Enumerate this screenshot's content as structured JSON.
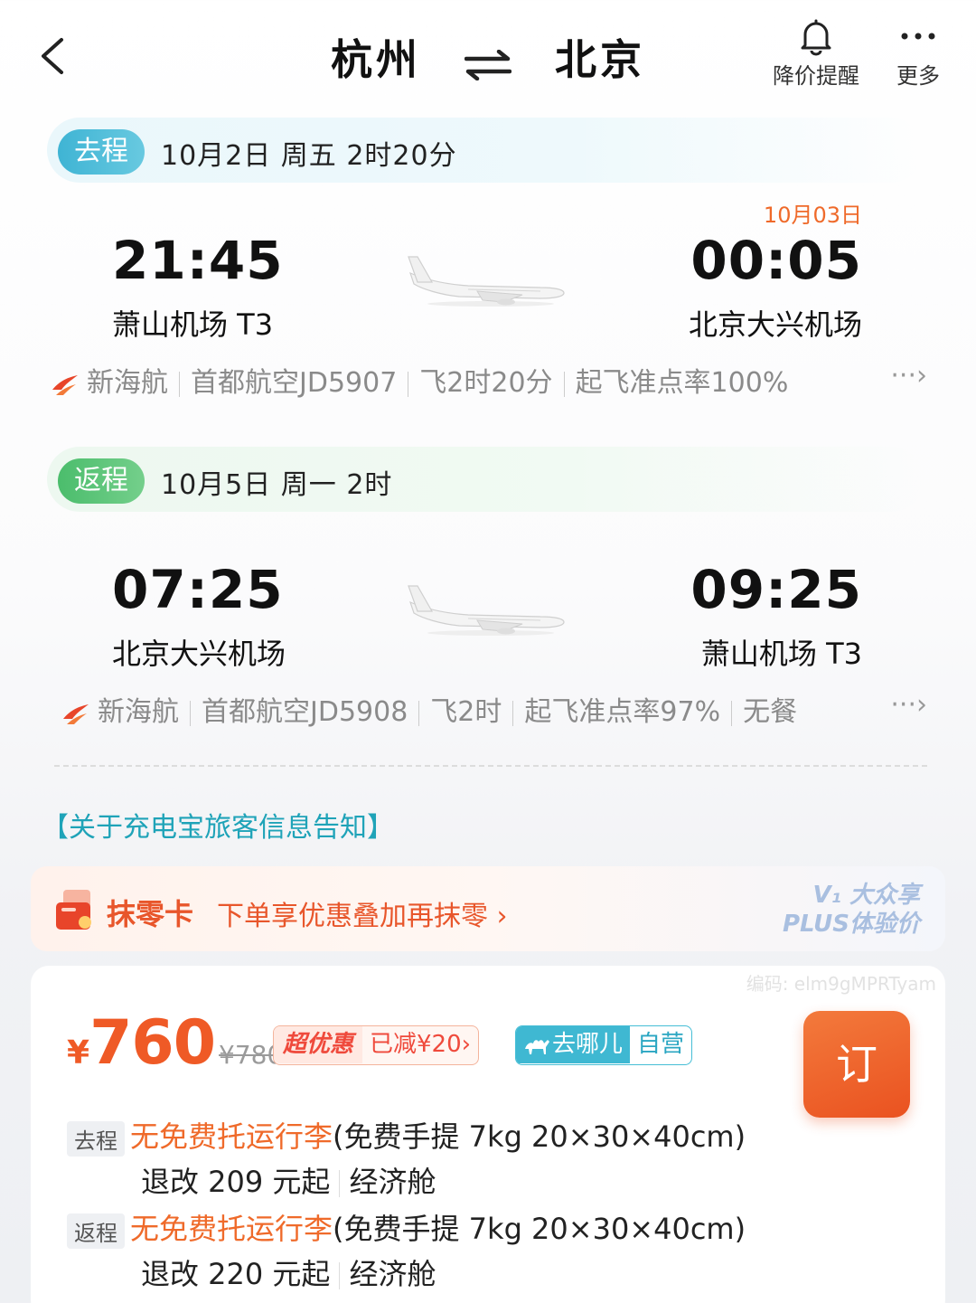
{
  "header": {
    "from_city": "杭州",
    "to_city": "北京",
    "price_alert_label": "降价提醒",
    "more_label": "更多"
  },
  "outbound": {
    "tag": "去程",
    "summary": "10月2日 周五  2时20分",
    "dep_time": "21:45",
    "dep_airport": "萧山机场 T3",
    "arr_time": "00:05",
    "arr_airport": "北京大兴机场",
    "arr_date_note": "10月03日",
    "info": [
      "新海航",
      "首都航空JD5907",
      "飞2时20分",
      "起飞准点率100%"
    ],
    "more": "···›"
  },
  "return": {
    "tag": "返程",
    "summary": "10月5日 周一  2时",
    "dep_time": "07:25",
    "dep_airport": "北京大兴机场",
    "arr_time": "09:25",
    "arr_airport": "萧山机场 T3",
    "info": [
      "新海航",
      "首都航空JD5908",
      "飞2时",
      "起飞准点率97%",
      "无餐"
    ],
    "more": "···›"
  },
  "notice": "【关于充电宝旅客信息告知】",
  "promo": {
    "title": "抹零卡",
    "desc": "下单享优惠叠加再抹零 ›",
    "badge_line1": "V₁ 大众享",
    "badge_line2": "PLUS体验价"
  },
  "booking": {
    "code": "编码: elm9gMPRTyam",
    "currency": "¥",
    "price": "760",
    "original_price": "¥780",
    "deal_tag": "超优惠",
    "deal_discount": "已减¥20›",
    "vendor": "去哪儿",
    "vendor_type": "自营",
    "order_label": "订",
    "outbound_tag": "去程",
    "outbound_baggage": "无免费托运行李",
    "outbound_carryon": "(免费手提 7kg 20×30×40cm)",
    "outbound_change": "退改 209 元起",
    "outbound_cabin": "经济舱",
    "return_tag": "返程",
    "return_baggage": "无免费托运行李",
    "return_carryon": "(免费手提 7kg 20×30×40cm)",
    "return_change": "退改 220 元起",
    "return_cabin": "经济舱"
  },
  "colors": {
    "accent_orange": "#ef5a26",
    "outbound_teal": "#3fb4d4",
    "return_green": "#4bbd6c",
    "notice_teal": "#1fa3b8"
  }
}
